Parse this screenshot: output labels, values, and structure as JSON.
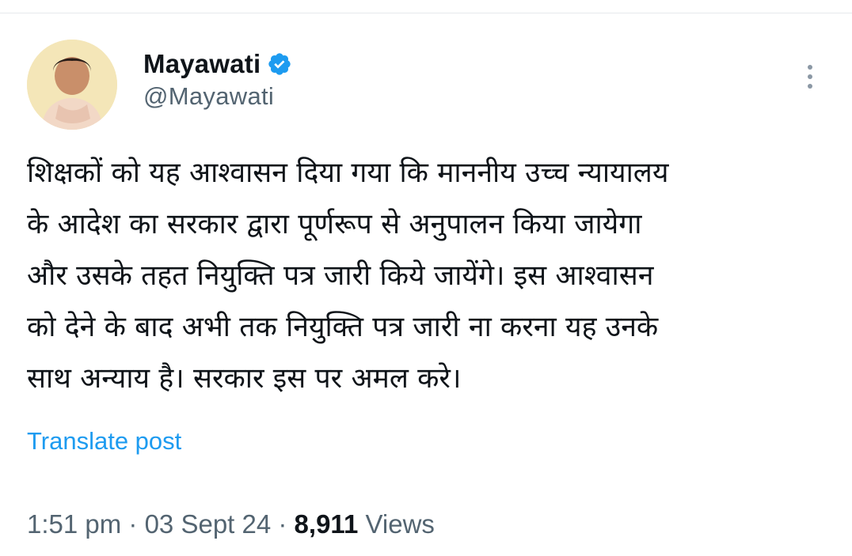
{
  "user": {
    "display_name": "Mayawati",
    "handle": "@Mayawati",
    "verified": true,
    "verified_color": "#1d9bf0"
  },
  "tweet": {
    "text": "शिक्षकों को यह आश्वासन दिया गया कि माननीय उच्च न्यायालय\nके आदेश का सरकार द्वारा पूर्णरूप से अनुपालन किया जायेगा\nऔर उसके तहत नियुक्ति पत्र जारी किये जायेंगे। इस आश्वासन\nको देने के बाद अभी तक नियुक्ति पत्र जारी ना करना यह उनके\nसाथ अन्याय है। सरकार इस पर अमल करे।",
    "translate_label": "Translate post"
  },
  "meta": {
    "time": "1:51 pm",
    "separator": " · ",
    "date": "03 Sept 24",
    "views_count": "8,911",
    "views_label": "Views"
  },
  "icons": {
    "verified": "verified-badge-icon",
    "more": "more-options-icon"
  },
  "colors": {
    "link": "#1d9bf0",
    "secondary_text": "#536471",
    "primary_text": "#0f1419"
  }
}
